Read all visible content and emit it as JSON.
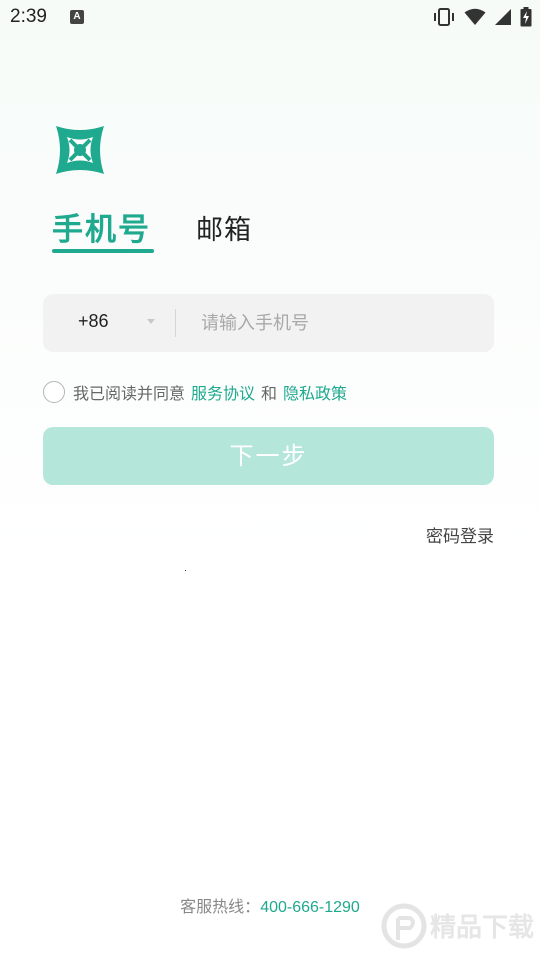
{
  "status_bar": {
    "time": "2:39",
    "notification_icon": "A",
    "icons": [
      "vibrate-icon",
      "wifi-icon",
      "signal-icon",
      "battery-charging-icon"
    ]
  },
  "logo": {
    "icon": "app-logo-icon",
    "color": "#1fa98f"
  },
  "tabs": {
    "phone_label": "手机号",
    "email_label": "邮箱",
    "active": "phone"
  },
  "phone_input": {
    "country_code": "+86",
    "placeholder": "请输入手机号",
    "value": ""
  },
  "agreement": {
    "prefix": "我已阅读并同意",
    "terms_link": "服务协议",
    "conjunction": "和",
    "privacy_link": "隐私政策",
    "checked": false
  },
  "next_button": {
    "label": "下一步",
    "enabled": false
  },
  "password_login": {
    "label": "密码登录"
  },
  "hotline": {
    "label": "客服热线：",
    "number": "400-666-1290"
  },
  "watermark": {
    "text": "精品下载"
  },
  "colors": {
    "accent": "#1fa98f",
    "button_disabled": "#b4e6da",
    "input_bg": "#f2f2f2"
  }
}
